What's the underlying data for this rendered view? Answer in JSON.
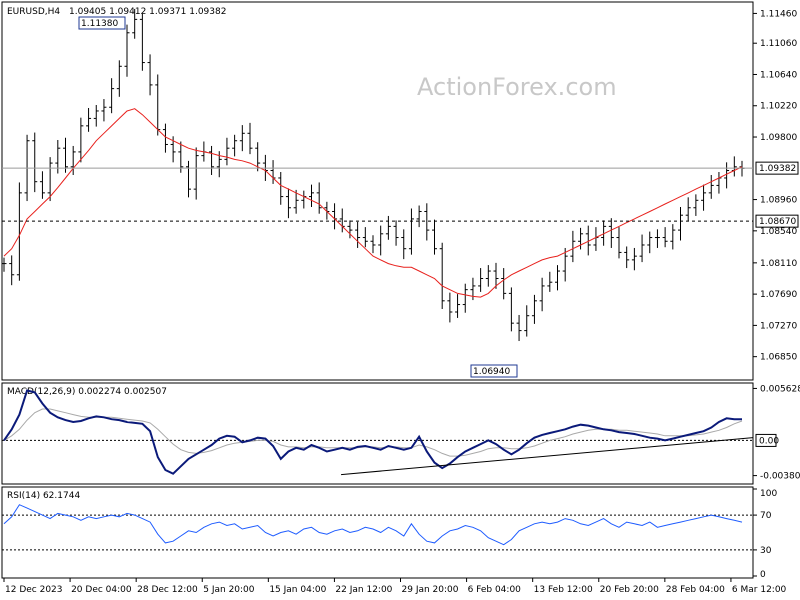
{
  "chart_data": [
    {
      "type": "candlestick",
      "panel": "price",
      "title": "EURUSD,H4",
      "ohlc_readout": "1.09405 1.09412 1.09371 1.09382",
      "watermark": "ActionForex.com",
      "ylim": [
        1.0655,
        1.116
      ],
      "y_ticks": [
        "1.11460",
        "1.11060",
        "1.10640",
        "1.10220",
        "1.09800",
        "1.09382",
        "1.08960",
        "1.08540",
        "1.08670",
        "1.08110",
        "1.07690",
        "1.07270",
        "1.06850"
      ],
      "x_ticks": [
        "12 Dec 2023",
        "20 Dec 04:00",
        "28 Dec 12:00",
        "5 Jan 20:00",
        "15 Jan 04:00",
        "22 Jan 12:00",
        "29 Jan 20:00",
        "6 Feb 04:00",
        "13 Feb 12:00",
        "20 Feb 20:00",
        "28 Feb 04:00",
        "6 Mar 12:00"
      ],
      "current_price": 1.09382,
      "current_price_label": "1.09382",
      "support_level": 1.0867,
      "support_label": "1.08670",
      "high_annotation": {
        "label": "1.11380",
        "value": 1.1138
      },
      "low_annotation": {
        "label": "1.06940",
        "value": 1.0694
      },
      "close_series": [
        1.081,
        1.0795,
        1.0905,
        1.0975,
        1.092,
        1.0905,
        1.0945,
        1.0965,
        1.094,
        1.096,
        1.0995,
        1.1005,
        1.1015,
        1.102,
        1.1045,
        1.1075,
        1.112,
        1.1138,
        1.108,
        1.105,
        1.099,
        1.097,
        1.096,
        1.094,
        1.091,
        1.0955,
        1.096,
        1.094,
        1.095,
        1.0965,
        1.0975,
        1.0985,
        1.0965,
        1.0945,
        1.0935,
        1.0925,
        1.09,
        1.0885,
        1.0895,
        1.09,
        1.0905,
        1.0885,
        1.088,
        1.087,
        1.086,
        1.0855,
        1.0845,
        1.084,
        1.0835,
        1.085,
        1.086,
        1.0845,
        1.083,
        1.087,
        1.088,
        1.0855,
        1.083,
        1.076,
        1.0745,
        1.0755,
        1.0775,
        1.078,
        1.079,
        1.08,
        1.079,
        1.077,
        1.073,
        1.072,
        1.074,
        1.076,
        1.078,
        1.0785,
        1.08,
        1.082,
        1.084,
        1.085,
        1.0835,
        1.0845,
        1.086,
        1.0845,
        1.0825,
        1.0815,
        1.082,
        1.0835,
        1.0845,
        1.0845,
        1.084,
        1.0855,
        1.0875,
        1.0885,
        1.0895,
        1.0905,
        1.0915,
        1.0925,
        1.0935,
        1.094,
        1.0938
      ],
      "ma_series": [
        1.082,
        1.083,
        1.0848,
        1.087,
        1.088,
        1.089,
        1.09,
        1.0912,
        1.0925,
        1.0938,
        1.095,
        1.0962,
        1.0975,
        1.0985,
        1.0995,
        1.1005,
        1.1015,
        1.1018,
        1.101,
        1.1,
        1.099,
        1.098,
        1.0975,
        1.097,
        1.0965,
        1.0962,
        1.096,
        1.0958,
        1.0955,
        1.0953,
        1.095,
        1.0948,
        1.0945,
        1.094,
        1.0935,
        1.0925,
        1.0915,
        1.091,
        1.0905,
        1.09,
        1.0895,
        1.089,
        1.088,
        1.087,
        1.086,
        1.085,
        1.084,
        1.083,
        1.082,
        1.0815,
        1.081,
        1.0807,
        1.0805,
        1.0805,
        1.08,
        1.0795,
        1.079,
        1.078,
        1.0775,
        1.077,
        1.0768,
        1.0766,
        1.0765,
        1.077,
        1.078,
        1.0788,
        1.0795,
        1.08,
        1.0805,
        1.081,
        1.0815,
        1.0818,
        1.082,
        1.0825,
        1.083,
        1.0835,
        1.084,
        1.0845,
        1.085,
        1.0855,
        1.086,
        1.0865,
        1.087,
        1.0875,
        1.088,
        1.0885,
        1.089,
        1.0895,
        1.09,
        1.0905,
        1.091,
        1.0915,
        1.092,
        1.0925,
        1.093,
        1.0935,
        1.094
      ]
    },
    {
      "type": "line",
      "panel": "macd",
      "title": "MACD(12,26,9) 0.002274 0.002507",
      "ylim": [
        -0.0045,
        0.006
      ],
      "y_ticks": [
        "0.005628",
        "0.00",
        "-0.003807"
      ],
      "current_tag": "0.00",
      "macd_series": [
        0.0,
        0.0012,
        0.0028,
        0.0054,
        0.0052,
        0.004,
        0.003,
        0.0025,
        0.0022,
        0.002,
        0.0021,
        0.0024,
        0.0026,
        0.0025,
        0.0023,
        0.0022,
        0.002,
        0.0019,
        0.0018,
        0.001,
        -0.0018,
        -0.0032,
        -0.0036,
        -0.0028,
        -0.002,
        -0.0015,
        -0.001,
        -0.0005,
        0.0002,
        0.0005,
        0.0004,
        -0.0002,
        0.0,
        0.0003,
        0.0002,
        -0.0006,
        -0.002,
        -0.0012,
        -0.0008,
        -0.001,
        -0.0005,
        -0.0008,
        -0.0012,
        -0.001,
        -0.0008,
        -0.001,
        -0.0007,
        -0.0006,
        -0.0008,
        -0.001,
        -0.0006,
        -0.0008,
        -0.001,
        -0.0008,
        0.0004,
        -0.0012,
        -0.0024,
        -0.003,
        -0.0025,
        -0.0018,
        -0.0012,
        -0.0008,
        -0.0004,
        0.0,
        -0.0004,
        -0.001,
        -0.0015,
        -0.001,
        -0.0003,
        0.0003,
        0.0006,
        0.0008,
        0.001,
        0.0012,
        0.0015,
        0.0017,
        0.0016,
        0.0014,
        0.0012,
        0.0011,
        0.0009,
        0.0008,
        0.0007,
        0.0005,
        0.0003,
        0.0002,
        0.0,
        0.0002,
        0.0004,
        0.0006,
        0.0008,
        0.001,
        0.0014,
        0.002,
        0.0024,
        0.0023,
        0.0023
      ],
      "signal_series": [
        0.0,
        0.0005,
        0.0012,
        0.0022,
        0.003,
        0.0034,
        0.0034,
        0.0032,
        0.003,
        0.0028,
        0.0026,
        0.0025,
        0.0025,
        0.0025,
        0.0025,
        0.0024,
        0.0023,
        0.0022,
        0.0021,
        0.0019,
        0.0012,
        0.0004,
        -0.0004,
        -0.001,
        -0.0013,
        -0.0014,
        -0.0013,
        -0.0011,
        -0.0008,
        -0.0005,
        -0.0003,
        -0.0002,
        -0.0001,
        0.0,
        0.0,
        -0.0001,
        -0.0005,
        -0.0007,
        -0.0007,
        -0.0008,
        -0.0007,
        -0.0007,
        -0.0008,
        -0.0008,
        -0.0008,
        -0.0008,
        -0.0008,
        -0.0007,
        -0.0007,
        -0.0008,
        -0.0007,
        -0.0007,
        -0.0008,
        -0.0008,
        -0.0005,
        -0.0007,
        -0.001,
        -0.0014,
        -0.0017,
        -0.0017,
        -0.0016,
        -0.0014,
        -0.0012,
        -0.0009,
        -0.0008,
        -0.0008,
        -0.0009,
        -0.0009,
        -0.0008,
        -0.0006,
        -0.0003,
        0.0,
        0.0002,
        0.0004,
        0.0007,
        0.0009,
        0.0011,
        0.0012,
        0.0012,
        0.0012,
        0.0011,
        0.0011,
        0.001,
        0.0009,
        0.0008,
        0.0007,
        0.0005,
        0.0005,
        0.0005,
        0.0005,
        0.0006,
        0.0007,
        0.0009,
        0.0011,
        0.0014,
        0.0018,
        0.0021
      ],
      "trendline": {
        "from": [
          -0.0037,
          0.45
        ],
        "to": [
          0.0003,
          1.0
        ]
      }
    },
    {
      "type": "line",
      "panel": "rsi",
      "title": "RSI(14) 62.1744",
      "ylim": [
        0,
        100
      ],
      "y_ticks": [
        "100",
        "70",
        "30",
        "0"
      ],
      "levels": [
        70,
        30
      ],
      "rsi_series": [
        60,
        68,
        82,
        78,
        74,
        70,
        66,
        72,
        70,
        68,
        64,
        68,
        66,
        68,
        70,
        68,
        72,
        70,
        66,
        62,
        48,
        38,
        40,
        46,
        52,
        50,
        56,
        60,
        62,
        58,
        60,
        54,
        56,
        58,
        50,
        46,
        50,
        52,
        48,
        54,
        56,
        50,
        48,
        52,
        54,
        50,
        52,
        56,
        54,
        50,
        56,
        52,
        46,
        60,
        48,
        40,
        38,
        46,
        52,
        54,
        58,
        56,
        52,
        44,
        40,
        36,
        42,
        52,
        56,
        60,
        62,
        60,
        62,
        66,
        64,
        60,
        58,
        62,
        66,
        60,
        56,
        62,
        60,
        58,
        62,
        56,
        58,
        60,
        62,
        64,
        66,
        68,
        70,
        68,
        66,
        64,
        62
      ]
    }
  ]
}
